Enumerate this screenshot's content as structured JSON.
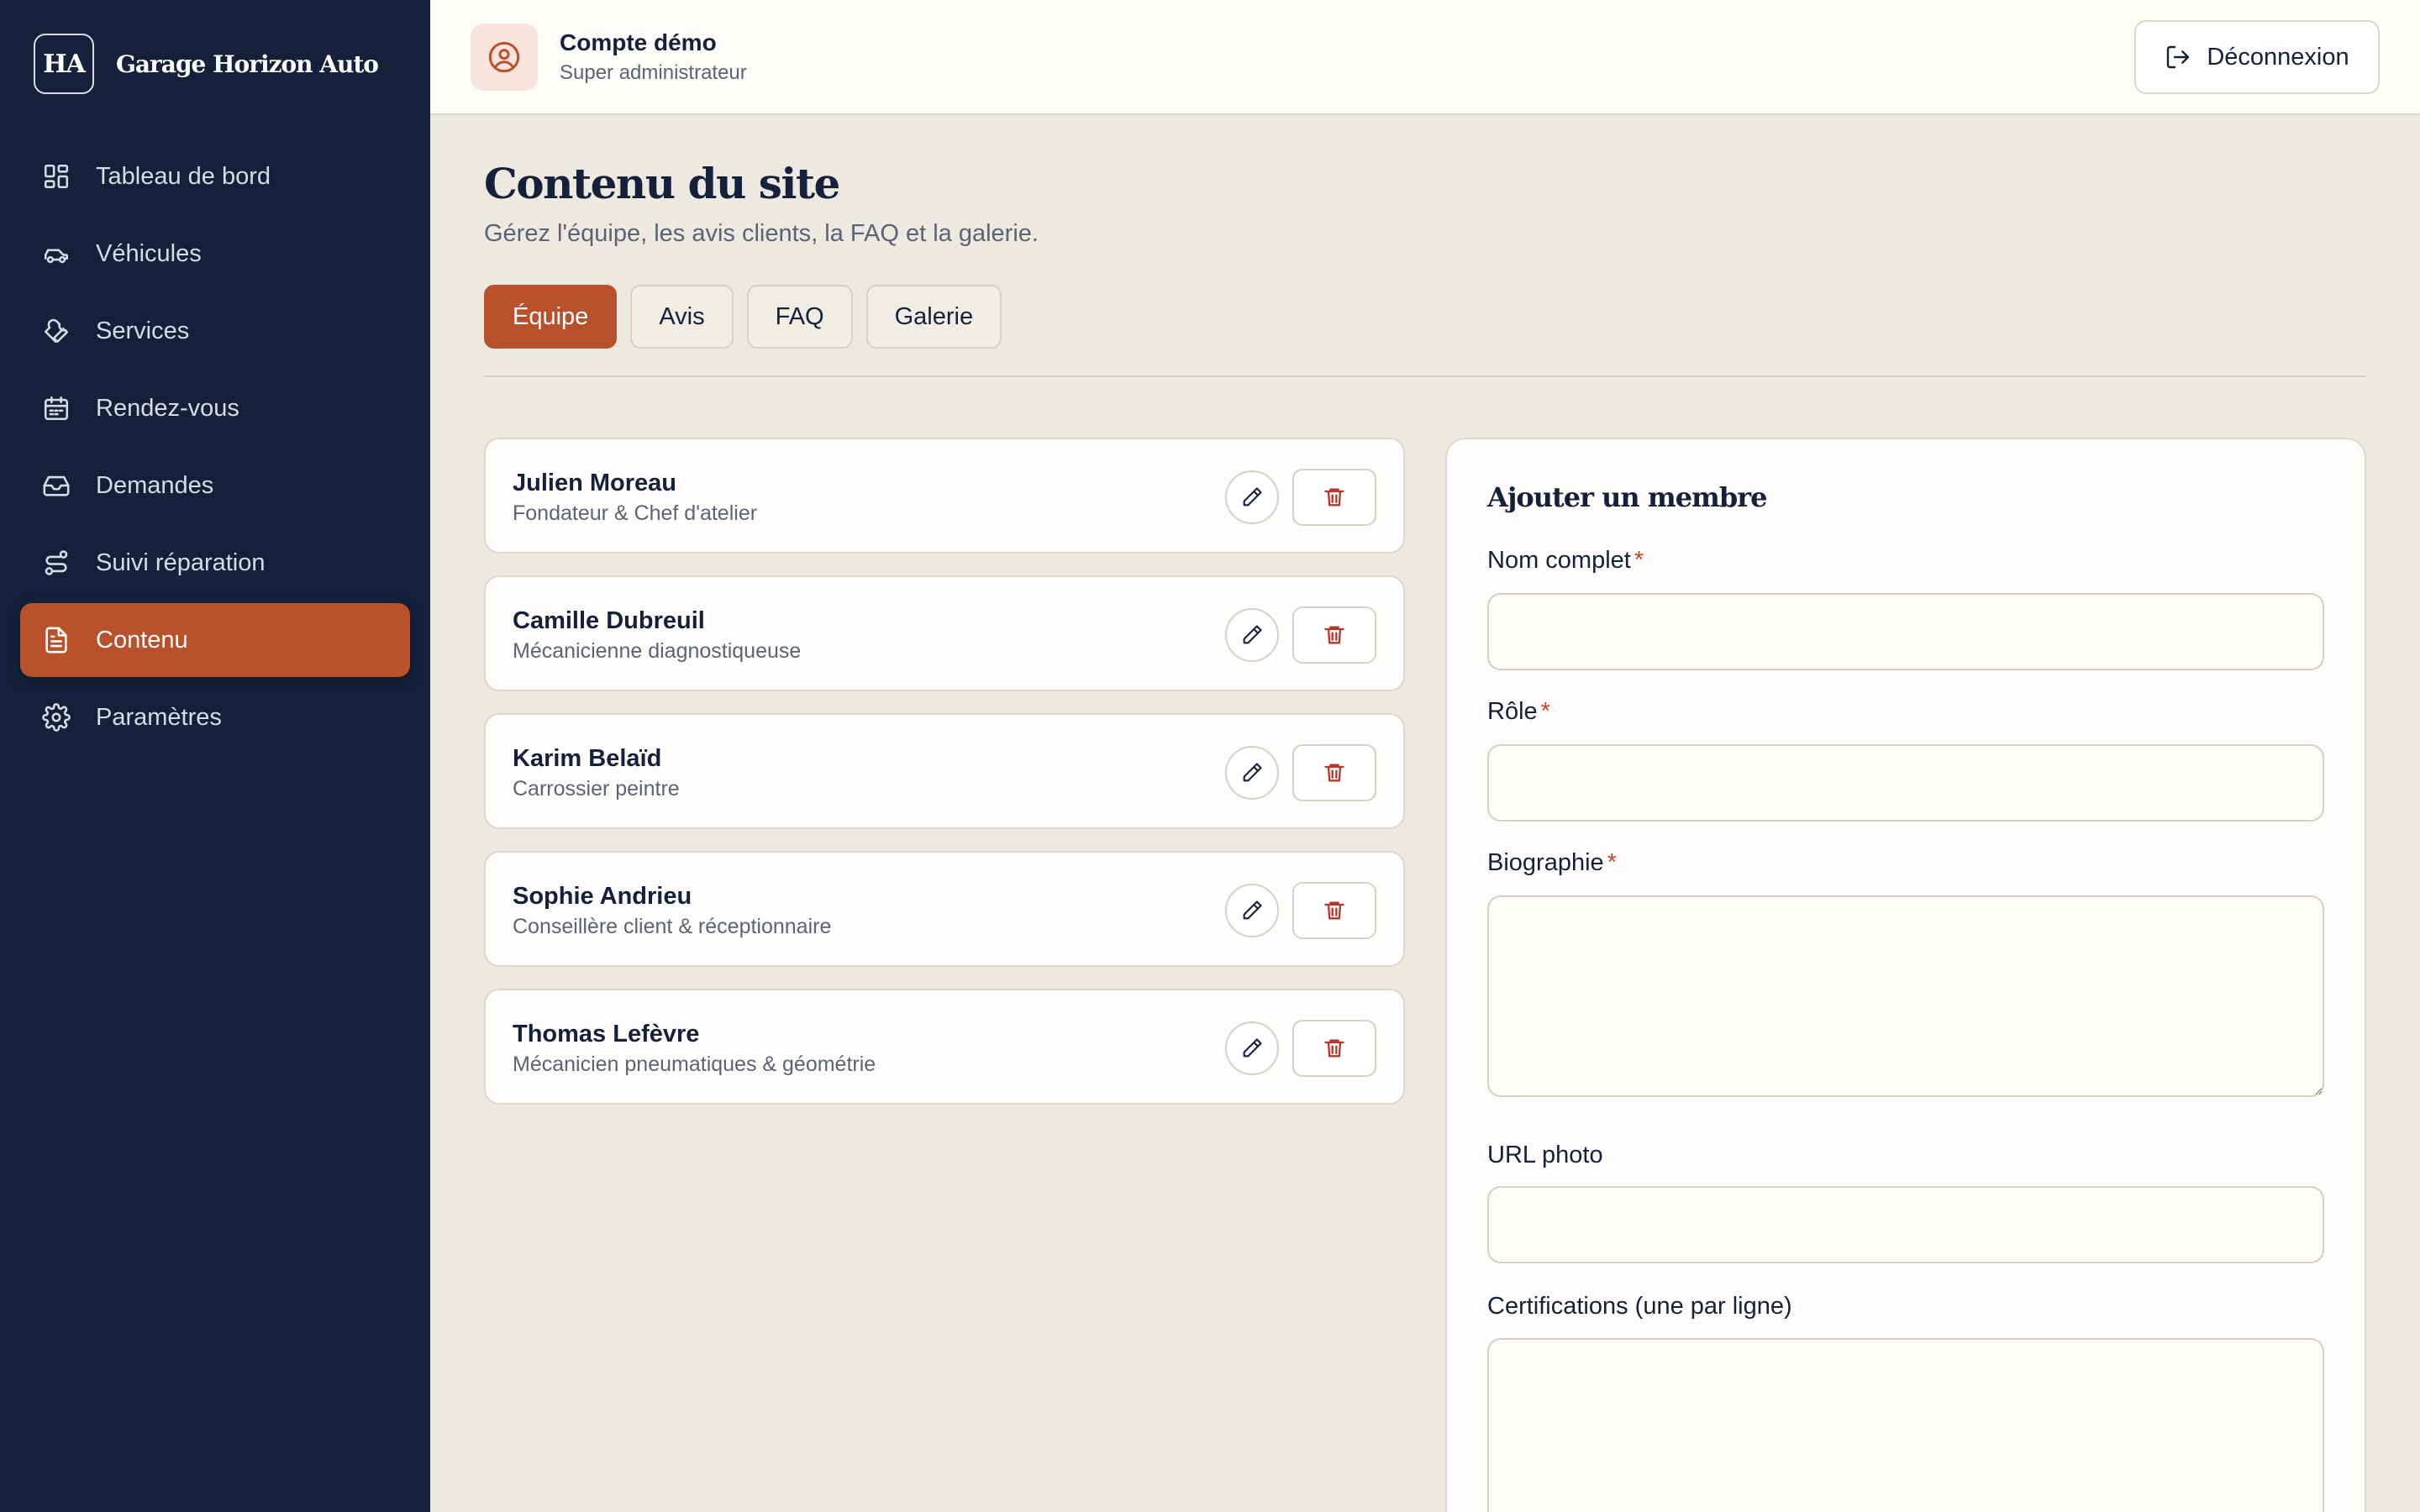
{
  "brand": {
    "logo_text": "HA",
    "name": "Garage Horizon Auto"
  },
  "sidebar": {
    "items": [
      {
        "label": "Tableau de bord",
        "icon": "dashboard-grid-icon"
      },
      {
        "label": "Véhicules",
        "icon": "car-icon"
      },
      {
        "label": "Services",
        "icon": "wrench-icon"
      },
      {
        "label": "Rendez-vous",
        "icon": "calendar-icon"
      },
      {
        "label": "Demandes",
        "icon": "inbox-icon"
      },
      {
        "label": "Suivi réparation",
        "icon": "route-icon"
      },
      {
        "label": "Contenu",
        "icon": "document-icon",
        "active": true
      },
      {
        "label": "Paramètres",
        "icon": "gear-icon"
      }
    ]
  },
  "header": {
    "account_name": "Compte démo",
    "account_role": "Super administrateur",
    "logout_label": "Déconnexion"
  },
  "main": {
    "title": "Contenu du site",
    "subtitle": "Gérez l'équipe, les avis clients, la FAQ et la galerie.",
    "tabs": [
      {
        "label": "Équipe",
        "active": true
      },
      {
        "label": "Avis"
      },
      {
        "label": "FAQ"
      },
      {
        "label": "Galerie"
      }
    ]
  },
  "members": [
    {
      "name": "Julien Moreau",
      "role": "Fondateur & Chef d'atelier"
    },
    {
      "name": "Camille Dubreuil",
      "role": "Mécanicienne diagnostiqueuse"
    },
    {
      "name": "Karim Belaïd",
      "role": "Carrossier peintre"
    },
    {
      "name": "Sophie Andrieu",
      "role": "Conseillère client & réceptionnaire"
    },
    {
      "name": "Thomas Lefèvre",
      "role": "Mécanicien pneumatiques & géométrie"
    }
  ],
  "form": {
    "title": "Ajouter un membre",
    "required_mark": "*",
    "fields": {
      "full_name": {
        "label": "Nom complet",
        "value": ""
      },
      "role": {
        "label": "Rôle",
        "value": ""
      },
      "bio": {
        "label": "Biographie",
        "value": ""
      },
      "photo_url": {
        "label": "URL photo",
        "value": ""
      },
      "certifications": {
        "label": "Certifications (une par ligne)",
        "value": ""
      }
    }
  },
  "colors": {
    "accent": "#b9512d",
    "sidebar_bg": "#15213a",
    "page_bg": "#ede9e0",
    "danger": "#b3372a"
  }
}
